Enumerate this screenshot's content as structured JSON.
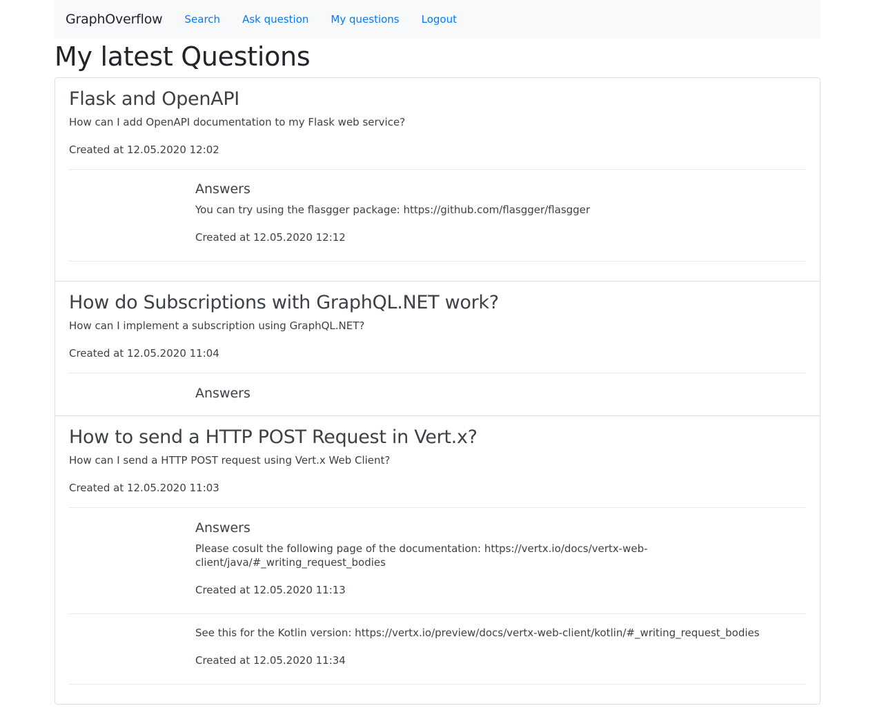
{
  "nav": {
    "brand": "GraphOverflow",
    "links": [
      "Search",
      "Ask question",
      "My questions",
      "Logout"
    ]
  },
  "page_title": "My latest Questions",
  "answers_heading": "Answers",
  "questions": [
    {
      "title": "Flask and OpenAPI",
      "body": "How can I add OpenAPI documentation to my Flask web service?",
      "created": "Created at 12.05.2020 12:02",
      "answers": [
        {
          "text": "You can try using the flasgger package: https://github.com/flasgger/flasgger",
          "created": "Created at 12.05.2020 12:12"
        }
      ]
    },
    {
      "title": "How do Subscriptions with GraphQL.NET work?",
      "body": "How can I implement a subscription using GraphQL.NET?",
      "created": "Created at 12.05.2020 11:04",
      "answers": []
    },
    {
      "title": "How to send a HTTP POST Request in Vert.x?",
      "body": "How can I send a HTTP POST request using Vert.x Web Client?",
      "created": "Created at 12.05.2020 11:03",
      "answers": [
        {
          "text": "Please cosult the following page of the documentation: https://vertx.io/docs/vertx-web-client/java/#_writing_request_bodies",
          "created": "Created at 12.05.2020 11:13"
        },
        {
          "text": "See this for the Kotlin version: https://vertx.io/preview/docs/vertx-web-client/kotlin/#_writing_request_bodies",
          "created": "Created at 12.05.2020 11:34"
        }
      ]
    }
  ]
}
